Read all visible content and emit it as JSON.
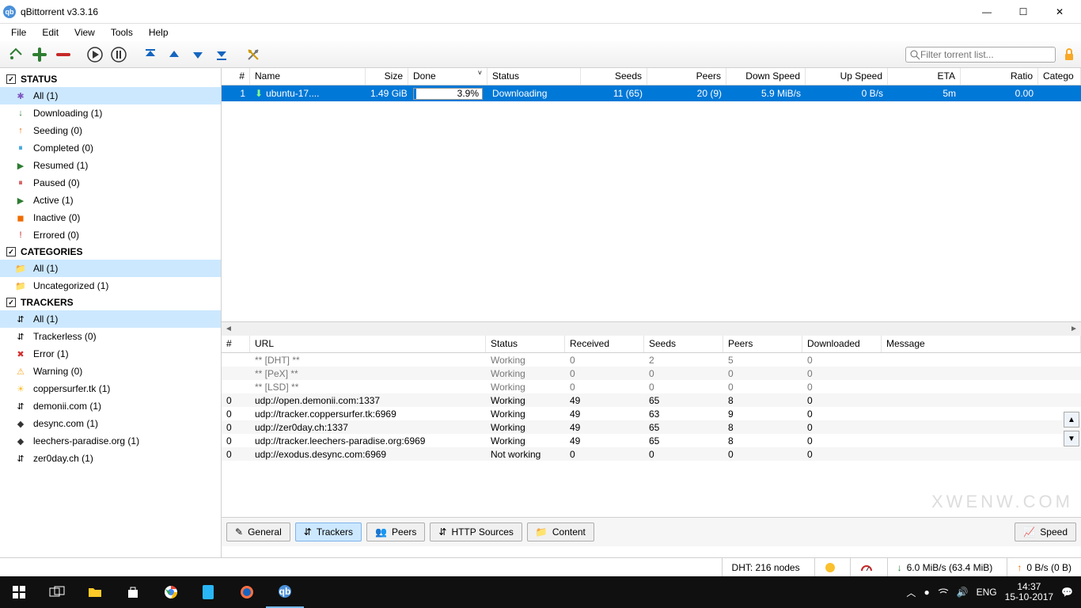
{
  "window": {
    "title": "qBittorrent v3.3.16"
  },
  "menu": [
    "File",
    "Edit",
    "View",
    "Tools",
    "Help"
  ],
  "filter": {
    "placeholder": "Filter torrent list..."
  },
  "sidebar": {
    "status": {
      "header": "STATUS",
      "items": [
        {
          "label": "All (1)",
          "color": "#7e57c2",
          "glyph": "✱"
        },
        {
          "label": "Downloading (1)",
          "color": "#2e7d32",
          "glyph": "↓"
        },
        {
          "label": "Seeding (0)",
          "color": "#ef6c00",
          "glyph": "↑"
        },
        {
          "label": "Completed (0)",
          "color": "#0288d1",
          "glyph": "⏸"
        },
        {
          "label": "Resumed (1)",
          "color": "#2e7d32",
          "glyph": "▶"
        },
        {
          "label": "Paused (0)",
          "color": "#c62828",
          "glyph": "⏸"
        },
        {
          "label": "Active (1)",
          "color": "#2e7d32",
          "glyph": "▶"
        },
        {
          "label": "Inactive (0)",
          "color": "#ef6c00",
          "glyph": "◼"
        },
        {
          "label": "Errored (0)",
          "color": "#c62828",
          "glyph": "!"
        }
      ]
    },
    "categories": {
      "header": "CATEGORIES",
      "items": [
        {
          "label": "All (1)",
          "glyph": "📁",
          "sel": true
        },
        {
          "label": "Uncategorized (1)",
          "glyph": "📁"
        }
      ]
    },
    "trackers": {
      "header": "TRACKERS",
      "items": [
        {
          "label": "All (1)",
          "glyph": "⇵",
          "sel": true
        },
        {
          "label": "Trackerless (0)",
          "glyph": "⇵"
        },
        {
          "label": "Error (1)",
          "glyph": "✖",
          "color": "#d32f2f"
        },
        {
          "label": "Warning (0)",
          "glyph": "⚠",
          "color": "#f9a825"
        },
        {
          "label": "coppersurfer.tk (1)",
          "glyph": "☀",
          "color": "#fbc02d"
        },
        {
          "label": "demonii.com (1)",
          "glyph": "⇵"
        },
        {
          "label": "desync.com (1)",
          "glyph": "◆",
          "color": "#333"
        },
        {
          "label": "leechers-paradise.org (1)",
          "glyph": "◆",
          "color": "#333"
        },
        {
          "label": "zer0day.ch (1)",
          "glyph": "⇵"
        }
      ]
    }
  },
  "cols": {
    "num": "#",
    "name": "Name",
    "size": "Size",
    "done": "Done",
    "status": "Status",
    "seeds": "Seeds",
    "peers": "Peers",
    "down": "Down Speed",
    "up": "Up Speed",
    "eta": "ETA",
    "ratio": "Ratio",
    "cat": "Catego"
  },
  "torrents": [
    {
      "num": "1",
      "name": "ubuntu-17....",
      "size": "1.49 GiB",
      "done": "3.9%",
      "progress": 3.9,
      "status": "Downloading",
      "seeds": "11 (65)",
      "peers": "20 (9)",
      "down": "5.9 MiB/s",
      "up": "0 B/s",
      "eta": "5m",
      "ratio": "0.00"
    }
  ],
  "trkcols": {
    "num": "#",
    "url": "URL",
    "status": "Status",
    "recv": "Received",
    "seeds": "Seeds",
    "peers": "Peers",
    "dl": "Downloaded",
    "msg": "Message"
  },
  "trackers_rows": [
    {
      "num": "",
      "url": "** [DHT] **",
      "status": "Working",
      "recv": "0",
      "seeds": "2",
      "peers": "5",
      "dl": "0",
      "dim": true
    },
    {
      "num": "",
      "url": "** [PeX] **",
      "status": "Working",
      "recv": "0",
      "seeds": "0",
      "peers": "0",
      "dl": "0",
      "dim": true
    },
    {
      "num": "",
      "url": "** [LSD] **",
      "status": "Working",
      "recv": "0",
      "seeds": "0",
      "peers": "0",
      "dl": "0",
      "dim": true
    },
    {
      "num": "0",
      "url": "udp://open.demonii.com:1337",
      "status": "Working",
      "recv": "49",
      "seeds": "65",
      "peers": "8",
      "dl": "0"
    },
    {
      "num": "0",
      "url": "udp://tracker.coppersurfer.tk:6969",
      "status": "Working",
      "recv": "49",
      "seeds": "63",
      "peers": "9",
      "dl": "0"
    },
    {
      "num": "0",
      "url": "udp://zer0day.ch:1337",
      "status": "Working",
      "recv": "49",
      "seeds": "65",
      "peers": "8",
      "dl": "0"
    },
    {
      "num": "0",
      "url": "udp://tracker.leechers-paradise.org:6969",
      "status": "Working",
      "recv": "49",
      "seeds": "65",
      "peers": "8",
      "dl": "0"
    },
    {
      "num": "0",
      "url": "udp://exodus.desync.com:6969",
      "status": "Not working",
      "recv": "0",
      "seeds": "0",
      "peers": "0",
      "dl": "0"
    }
  ],
  "tabs": {
    "general": "General",
    "trackers": "Trackers",
    "peers": "Peers",
    "http": "HTTP Sources",
    "content": "Content",
    "speed": "Speed"
  },
  "status": {
    "dht": "DHT: 216 nodes",
    "down": "6.0 MiB/s (63.4 MiB)",
    "up": "0 B/s (0 B)"
  },
  "clock": {
    "time": "14:37",
    "date": "15-10-2017",
    "lang": "ENG"
  },
  "watermark": "XWENW.COM"
}
